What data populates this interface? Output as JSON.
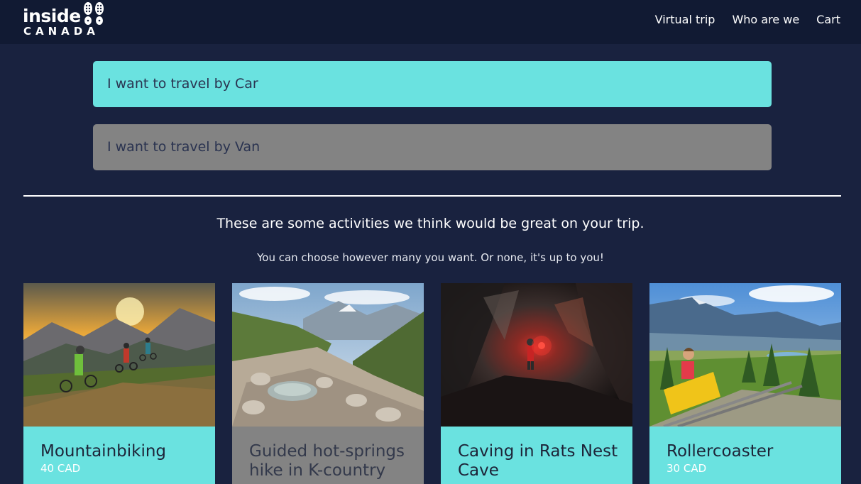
{
  "brand": {
    "line1": "inside",
    "line2": "CANADA",
    "icon": "boot-prints-icon"
  },
  "nav": [
    {
      "label": "Virtual trip"
    },
    {
      "label": "Who are we"
    },
    {
      "label": "Cart"
    }
  ],
  "options": [
    {
      "label": "I want to travel by Car",
      "selected": true
    },
    {
      "label": "I want to travel by Van",
      "selected": false
    }
  ],
  "intro": {
    "headline": "These are some activities we think would be great on your trip.",
    "subline": "You can choose however many you want. Or none, it's up to you!"
  },
  "activities": [
    {
      "title": "Mountainbiking",
      "price": "40 CAD",
      "image": "mountain-bikers-at-sunset-photo"
    },
    {
      "title": "Guided hot-springs hike in K-country",
      "price": "",
      "image": "hot-springs-mountain-valley-photo"
    },
    {
      "title": "Caving in Rats Nest Cave",
      "price": "",
      "image": "cave-explorer-with-red-light-photo"
    },
    {
      "title": "Rollercoaster",
      "price": "30 CAD",
      "image": "mountain-coaster-rider-photo"
    }
  ],
  "colors": {
    "background": "#19223f",
    "navbar": "#111a33",
    "accent": "#6ae2e0",
    "disabled": "#838383"
  }
}
